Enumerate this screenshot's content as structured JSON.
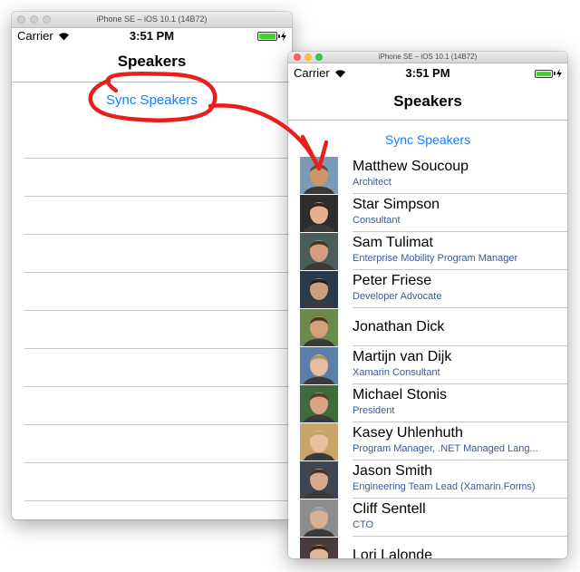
{
  "left_window": {
    "title": "iPhone SE – iOS 10.1 (14B72)",
    "carrier": "Carrier",
    "time": "3:51 PM",
    "nav_title": "Speakers",
    "sync_button": "Sync Speakers"
  },
  "right_window": {
    "title": "iPhone SE – iOS 10.1 (14B72)",
    "carrier": "Carrier",
    "time": "3:51 PM",
    "nav_title": "Speakers",
    "sync_button": "Sync Speakers",
    "speakers": [
      {
        "name": "Matthew Soucoup",
        "title": "Architect"
      },
      {
        "name": "Star Simpson",
        "title": "Consultant"
      },
      {
        "name": "Sam Tulimat",
        "title": "Enterprise Mobility Program Manager"
      },
      {
        "name": "Peter Friese",
        "title": "Developer Advocate"
      },
      {
        "name": "Jonathan Dick",
        "title": ""
      },
      {
        "name": "Martijn van Dijk",
        "title": "Xamarin Consultant"
      },
      {
        "name": "Michael Stonis",
        "title": "President"
      },
      {
        "name": "Kasey Uhlenhuth",
        "title": "Program Manager, .NET Managed Lang..."
      },
      {
        "name": "Jason Smith",
        "title": "Engineering Team Lead (Xamarin.Forms)"
      },
      {
        "name": "Cliff Sentell",
        "title": "CTO"
      },
      {
        "name": "Lori Lalonde",
        "title": ""
      }
    ]
  },
  "colors": {
    "link": "#147efb",
    "subtitle": "#3a5a98",
    "annotation": "#e8201c",
    "battery": "#3dd62b",
    "close": "#fc605c",
    "minimize": "#fdbc40",
    "zoom": "#34c84a"
  }
}
